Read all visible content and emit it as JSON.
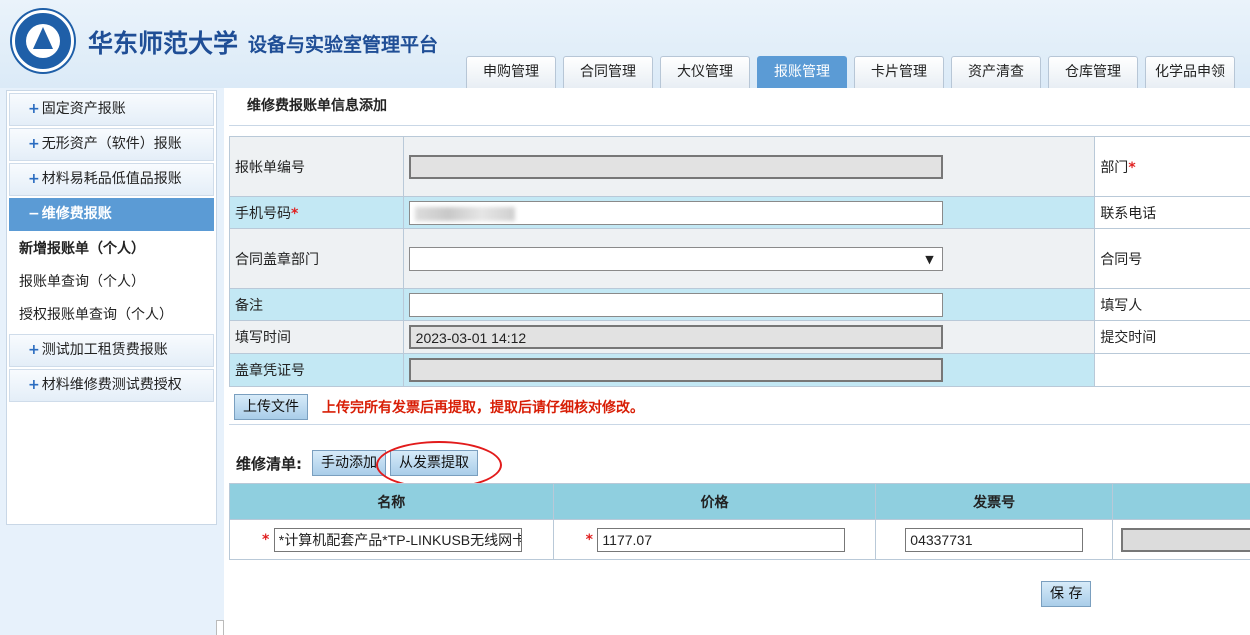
{
  "header": {
    "university": "华东师范大学",
    "platform": "设备与实验室管理平台",
    "tabs": [
      {
        "label": "申购管理",
        "active": false
      },
      {
        "label": "合同管理",
        "active": false
      },
      {
        "label": "大仪管理",
        "active": false
      },
      {
        "label": "报账管理",
        "active": true
      },
      {
        "label": "卡片管理",
        "active": false
      },
      {
        "label": "资产清查",
        "active": false
      },
      {
        "label": "仓库管理",
        "active": false
      },
      {
        "label": "化学品申领",
        "active": false
      }
    ]
  },
  "sidebar": {
    "items": [
      {
        "label": "固定资产报账",
        "icon": "+"
      },
      {
        "label": "无形资产（软件）报账",
        "icon": "+"
      },
      {
        "label": "材料易耗品低值品报账",
        "icon": "+"
      },
      {
        "label": "维修费报账",
        "icon": "−"
      }
    ],
    "subitems": [
      {
        "label": "新增报账单（个人）"
      },
      {
        "label": "报账单查询（个人）"
      },
      {
        "label": "授权报账单查询（个人）"
      }
    ],
    "items2": [
      {
        "label": "测试加工租赁费报账",
        "icon": "+"
      },
      {
        "label": "材料维修费测试费授权",
        "icon": "+"
      }
    ]
  },
  "page": {
    "title": "维修费报账单信息添加"
  },
  "form": {
    "labels": {
      "bill_no": "报帐单编号",
      "phone": "手机号码",
      "seal_dept": "合同盖章部门",
      "remark": "备注",
      "fill_time": "填写时间",
      "seal_voucher": "盖章凭证号",
      "dept": "部门",
      "contact_phone": "联系电话",
      "contract_no": "合同号",
      "filler": "填写人",
      "submit_time": "提交时间"
    },
    "required_mark": "*",
    "values": {
      "bill_no": "",
      "remark": "",
      "fill_time": "2023-03-01 14:12",
      "seal_voucher": ""
    }
  },
  "upload": {
    "button": "上传文件",
    "warning": "上传完所有发票后再提取，提取后请仔细核对修改。"
  },
  "repair": {
    "label": "维修清单:",
    "manual_add": "手动添加",
    "extract": "从发票提取",
    "columns": [
      "名称",
      "价格",
      "发票号"
    ],
    "rows": [
      {
        "name": "*计算机配套产品*TP-LINKUSB无线网卡",
        "price": "1177.07",
        "invoice": "04337731"
      }
    ]
  },
  "actions": {
    "save": "保 存"
  },
  "colors": {
    "accent": "#5b9bd5",
    "row_blue": "#c3e8f4",
    "table_header": "#8fcfdf",
    "warning": "#d81e06"
  }
}
